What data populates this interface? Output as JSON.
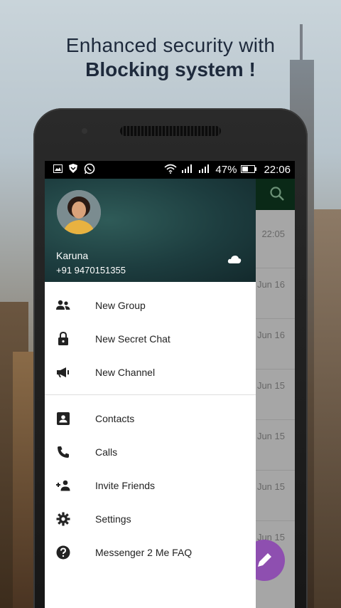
{
  "headline": {
    "line1": "Enhanced security with",
    "line2": "Blocking system !"
  },
  "status_bar": {
    "battery": "47%",
    "time": "22:06",
    "left_icons": [
      "image-icon",
      "shield-icon",
      "whatsapp-icon"
    ],
    "right_icons": [
      "wifi-icon",
      "signal-icon",
      "signal-icon",
      "battery-icon"
    ]
  },
  "background_chats": {
    "times": [
      "22:05",
      "Jun 16",
      "Jun 16",
      "Jun 15",
      "Jun 15",
      "Jun 15",
      "Jun 15"
    ]
  },
  "drawer": {
    "user": {
      "name": "Karuna",
      "phone": "+91 9470151355"
    },
    "menu_primary": [
      {
        "label": "New Group",
        "icon": "group-icon"
      },
      {
        "label": "New Secret Chat",
        "icon": "lock-icon"
      },
      {
        "label": "New Channel",
        "icon": "megaphone-icon"
      }
    ],
    "menu_secondary": [
      {
        "label": "Contacts",
        "icon": "contact-card-icon"
      },
      {
        "label": "Calls",
        "icon": "phone-icon"
      },
      {
        "label": "Invite Friends",
        "icon": "add-person-icon"
      },
      {
        "label": "Settings",
        "icon": "gear-icon"
      },
      {
        "label": "Messenger 2 Me FAQ",
        "icon": "help-icon"
      }
    ]
  },
  "colors": {
    "app_bar": "#0f3d22",
    "drawer_header": "#1d3d3f",
    "fab": "#8e4fb0",
    "headline_text": "#1e2a3c"
  }
}
